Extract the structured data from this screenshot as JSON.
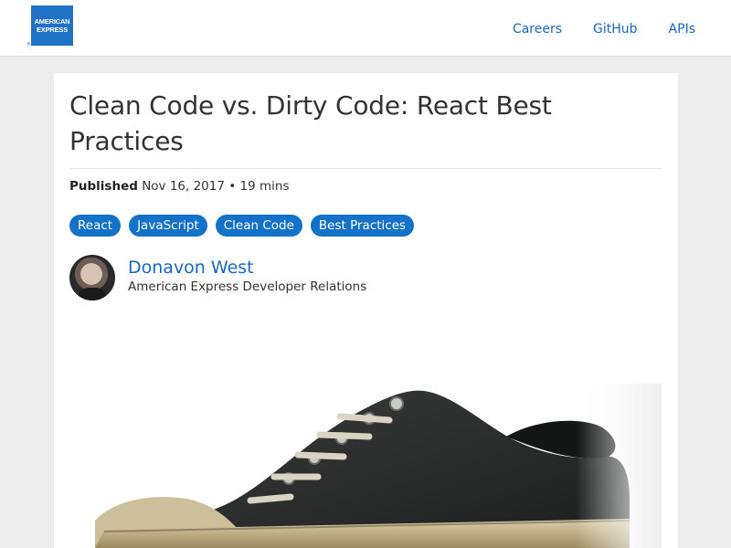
{
  "header": {
    "logo": {
      "line1": "AMERICAN",
      "line2": "EXPRESS",
      "mark": "®"
    },
    "nav": [
      {
        "label": "Careers"
      },
      {
        "label": "GitHub"
      },
      {
        "label": "APIs"
      }
    ]
  },
  "article": {
    "title": "Clean Code vs. Dirty Code: React Best Practices",
    "published_label": "Published",
    "published_date": "Nov 16, 2017",
    "separator": "•",
    "read_time": "19 mins",
    "tags": [
      "React",
      "JavaScript",
      "Clean Code",
      "Best Practices"
    ],
    "author": {
      "name": "Donavon West",
      "role": "American Express Developer Relations"
    },
    "hero_image": "dirty-sneaker-image"
  },
  "colors": {
    "brand_blue": "#1f72c8",
    "link_blue": "#1669c1",
    "tag_blue": "#1471c8",
    "page_bg": "#ececec"
  }
}
